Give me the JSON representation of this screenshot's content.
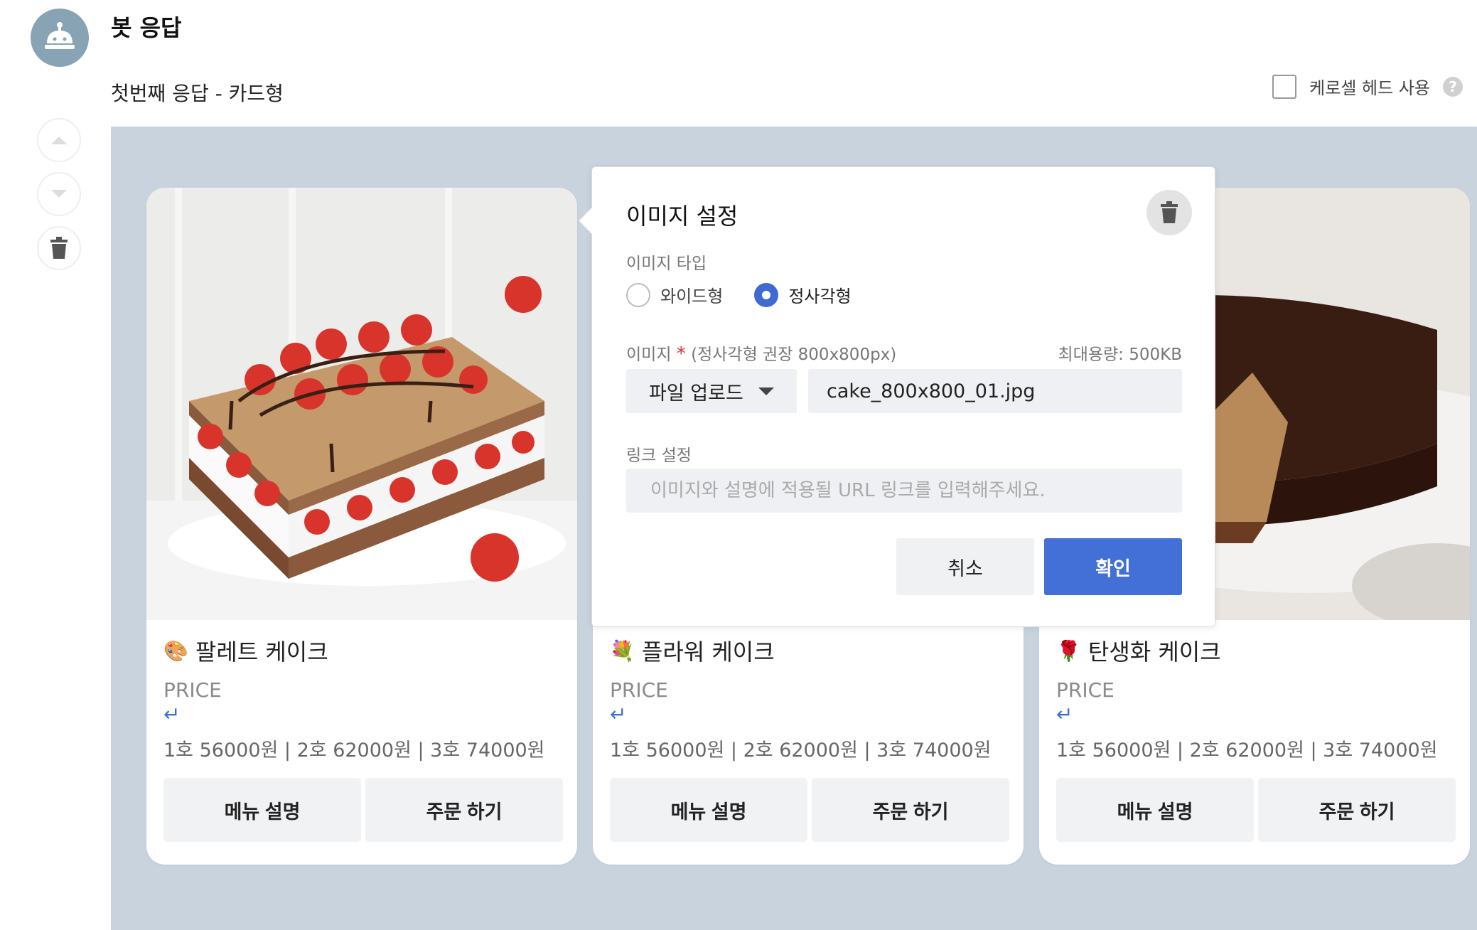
{
  "header": {
    "title": "봇 응답",
    "subtitle": "첫번째 응답 - 카드형",
    "carousel_head_label": "케로셀 헤드 사용",
    "help_glyph": "?"
  },
  "side_controls": [
    "chevron-up-icon",
    "chevron-down-icon",
    "trash-icon"
  ],
  "cards": [
    {
      "emoji": "🎨",
      "title": "팔레트 케이크",
      "price_label": "PRICE",
      "enter_glyph": "↵",
      "price_line": "1호 56000원 | 2호 62000원 | 3호 74000원",
      "buttons": [
        "메뉴 설명",
        "주문 하기"
      ],
      "image": "strawberry-cake-photo"
    },
    {
      "emoji": "💐",
      "title": "플라워 케이크",
      "price_label": "PRICE",
      "enter_glyph": "↵",
      "price_line": "1호 56000원 | 2호 62000원 | 3호 74000원",
      "buttons": [
        "메뉴 설명",
        "주문 하기"
      ],
      "image": "hidden-behind-popup"
    },
    {
      "emoji": "🌹",
      "title": "탄생화 케이크",
      "price_label": "PRICE",
      "enter_glyph": "↵",
      "price_line": "1호 56000원 | 2호 62000원 | 3호 74000원",
      "buttons": [
        "메뉴 설명",
        "주문 하기"
      ],
      "image": "chocolate-cake-photo"
    }
  ],
  "popup": {
    "title": "이미지 설정",
    "image_type_label": "이미지 타입",
    "radio_options": [
      {
        "label": "와이드형",
        "selected": false
      },
      {
        "label": "정사각형",
        "selected": true
      }
    ],
    "image_label": "이미지",
    "required_mark": "*",
    "image_hint": "(정사각형 권장 800x800px)",
    "max_size": "최대용량: 500KB",
    "upload_select": "파일 업로드",
    "file_name": "cake_800x800_01.jpg",
    "link_label": "링크 설정",
    "link_placeholder": "이미지와 설명에 적용될 URL 링크를 입력해주세요.",
    "cancel": "취소",
    "confirm": "확인"
  },
  "colors": {
    "canvas_bg": "#c8d3de",
    "accent": "#4270d6",
    "avatar": "#88a3b3"
  }
}
